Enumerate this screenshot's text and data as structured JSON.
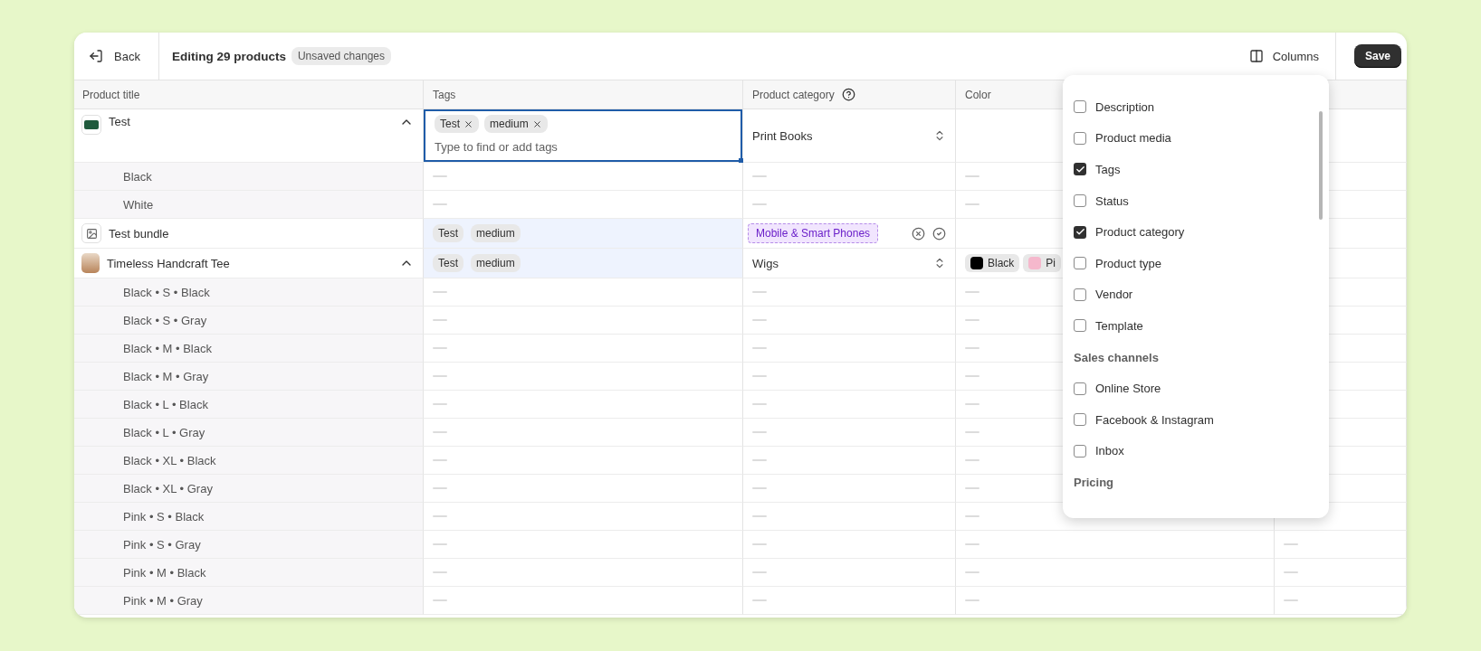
{
  "header": {
    "back_label": "Back",
    "title": "Editing 29 products",
    "badge": "Unsaved changes",
    "columns_label": "Columns",
    "save_label": "Save"
  },
  "columns": [
    {
      "label": "Product title"
    },
    {
      "label": "Tags"
    },
    {
      "label": "Product category",
      "help": true
    },
    {
      "label": "Color"
    }
  ],
  "rows": [
    {
      "kind": "product",
      "title": "Test",
      "thumbnail": {
        "kind": "logo"
      },
      "expanded": true,
      "tags": {
        "editing": true,
        "highlighted": false,
        "items": [
          "Test",
          "medium"
        ],
        "placeholder": "Type to find or add tags"
      },
      "category": {
        "kind": "select",
        "value": "Print Books"
      },
      "colors": []
    },
    {
      "kind": "variant",
      "title": "Black"
    },
    {
      "kind": "variant",
      "title": "White"
    },
    {
      "kind": "product",
      "title": "Test bundle",
      "thumbnail": {
        "kind": "image"
      },
      "tags": {
        "editing": false,
        "highlighted": true,
        "items": [
          "Test",
          "medium"
        ]
      },
      "category": {
        "kind": "pending",
        "value": "Mobile & Smart Phones"
      },
      "colors": []
    },
    {
      "kind": "product",
      "title": "Timeless Handcraft Tee",
      "thumbnail": {
        "kind": "photo"
      },
      "expanded": true,
      "tags": {
        "editing": false,
        "highlighted": true,
        "items": [
          "Test",
          "medium"
        ]
      },
      "category": {
        "kind": "select",
        "value": "Wigs"
      },
      "colors": [
        {
          "label": "Black",
          "color": "#000000"
        },
        {
          "label": "Pi",
          "color": "#f5b8cc"
        }
      ]
    },
    {
      "kind": "variant",
      "title": "Black • S • Black"
    },
    {
      "kind": "variant",
      "title": "Black • S • Gray"
    },
    {
      "kind": "variant",
      "title": "Black • M • Black"
    },
    {
      "kind": "variant",
      "title": "Black • M • Gray"
    },
    {
      "kind": "variant",
      "title": "Black • L • Black"
    },
    {
      "kind": "variant",
      "title": "Black • L • Gray"
    },
    {
      "kind": "variant",
      "title": "Black • XL • Black"
    },
    {
      "kind": "variant",
      "title": "Black • XL • Gray"
    },
    {
      "kind": "variant",
      "title": "Pink • S • Black"
    },
    {
      "kind": "variant",
      "title": "Pink • S • Gray"
    },
    {
      "kind": "variant",
      "title": "Pink • M • Black"
    },
    {
      "kind": "variant",
      "title": "Pink • M • Gray"
    }
  ],
  "column_menu": {
    "items": [
      {
        "kind": "checkbox",
        "label": "Description",
        "checked": false
      },
      {
        "kind": "checkbox",
        "label": "Product media",
        "checked": false
      },
      {
        "kind": "checkbox",
        "label": "Tags",
        "checked": true
      },
      {
        "kind": "checkbox",
        "label": "Status",
        "checked": false
      },
      {
        "kind": "checkbox",
        "label": "Product category",
        "checked": true
      },
      {
        "kind": "checkbox",
        "label": "Product type",
        "checked": false
      },
      {
        "kind": "checkbox",
        "label": "Vendor",
        "checked": false
      },
      {
        "kind": "checkbox",
        "label": "Template",
        "checked": false
      },
      {
        "kind": "heading",
        "label": "Sales channels"
      },
      {
        "kind": "checkbox",
        "label": "Online Store",
        "checked": false
      },
      {
        "kind": "checkbox",
        "label": "Facebook & Instagram",
        "checked": false
      },
      {
        "kind": "checkbox",
        "label": "Inbox",
        "checked": false
      },
      {
        "kind": "heading",
        "label": "Pricing"
      }
    ]
  }
}
